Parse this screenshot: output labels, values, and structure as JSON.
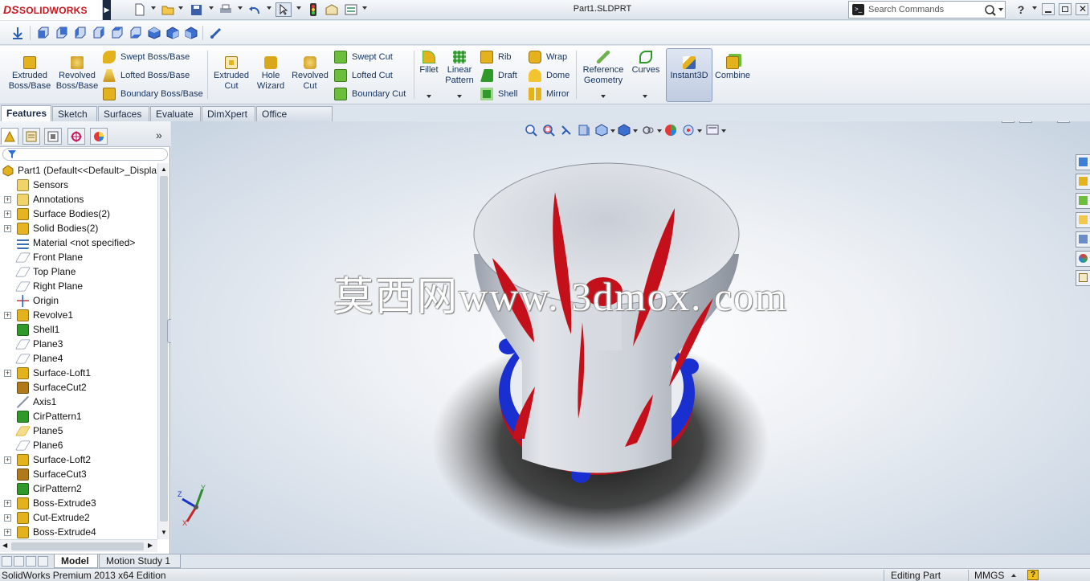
{
  "app": {
    "logo_ds": "DS",
    "logo_text": "SOLIDWORKS",
    "doc_title": "Part1.SLDPRT"
  },
  "search": {
    "placeholder": "Search Commands"
  },
  "ribbon": {
    "big_buttons": [
      {
        "id": "extruded-boss-base",
        "label1": "Extruded",
        "label2": "Boss/Base",
        "color": "#e3b21c"
      },
      {
        "id": "revolved-boss-base",
        "label1": "Revolved",
        "label2": "Boss/Base",
        "color": "#e3b21c"
      },
      {
        "id": "extruded-cut",
        "label1": "Extruded",
        "label2": "Cut",
        "color": "#e3b21c"
      },
      {
        "id": "hole-wizard",
        "label1": "Hole",
        "label2": "Wizard",
        "color": "#d9a81a"
      },
      {
        "id": "revolved-cut",
        "label1": "Revolved",
        "label2": "Cut",
        "color": "#e3b21c"
      },
      {
        "id": "fillet",
        "label1": "Fillet",
        "label2": "",
        "color": "#4fb836"
      },
      {
        "id": "linear-pattern",
        "label1": "Linear",
        "label2": "Pattern",
        "color": "#2f9a2a"
      },
      {
        "id": "reference-geometry",
        "label1": "Reference",
        "label2": "Geometry",
        "color": "#6db24a"
      },
      {
        "id": "curves",
        "label1": "Curves",
        "label2": "",
        "color": "#2f9a2a"
      },
      {
        "id": "instant3d",
        "label1": "Instant3D",
        "label2": "",
        "color": "#8aa6cf"
      },
      {
        "id": "combine",
        "label1": "Combine",
        "label2": "",
        "color": "#e3b21c"
      }
    ],
    "small_buttons": [
      {
        "id": "swept-boss-base",
        "label": "Swept Boss/Base",
        "color": "#e3b21c"
      },
      {
        "id": "lofted-boss-base",
        "label": "Lofted Boss/Base",
        "color": "#e3b21c"
      },
      {
        "id": "boundary-boss-base",
        "label": "Boundary Boss/Base",
        "color": "#e3b21c"
      },
      {
        "id": "swept-cut",
        "label": "Swept Cut",
        "color": "#6bbf3a"
      },
      {
        "id": "lofted-cut",
        "label": "Lofted Cut",
        "color": "#6bbf3a"
      },
      {
        "id": "boundary-cut",
        "label": "Boundary Cut",
        "color": "#6bbf3a"
      },
      {
        "id": "rib",
        "label": "Rib",
        "color": "#e3b21c"
      },
      {
        "id": "draft",
        "label": "Draft",
        "color": "#2f9a2a"
      },
      {
        "id": "shell",
        "label": "Shell",
        "color": "#2f9a2a"
      },
      {
        "id": "wrap",
        "label": "Wrap",
        "color": "#e3b21c"
      },
      {
        "id": "dome",
        "label": "Dome",
        "color": "#e3b21c"
      },
      {
        "id": "mirror",
        "label": "Mirror",
        "color": "#e3b21c"
      }
    ]
  },
  "tabs": [
    "Features",
    "Sketch",
    "Surfaces",
    "Evaluate",
    "DimXpert",
    "Office Products"
  ],
  "tree": {
    "root": "Part1  (Default<<Default>_Displa",
    "items": [
      {
        "label": "Sensors",
        "icon": "sensor-icon",
        "color": "#f0d46a",
        "expand": false
      },
      {
        "label": "Annotations",
        "icon": "annotations-icon",
        "color": "#f0d46a",
        "expand": true
      },
      {
        "label": "Surface Bodies(2)",
        "icon": "surface-bodies-icon",
        "color": "#e6b422",
        "expand": true
      },
      {
        "label": "Solid Bodies(2)",
        "icon": "solid-bodies-icon",
        "color": "#e6b422",
        "expand": true
      },
      {
        "label": "Material <not specified>",
        "icon": "material-icon",
        "color": "#3b6db5",
        "expand": false
      },
      {
        "label": "Front Plane",
        "icon": "plane-icon",
        "color": "#8a97a8",
        "expand": false
      },
      {
        "label": "Top Plane",
        "icon": "plane-icon",
        "color": "#8a97a8",
        "expand": false
      },
      {
        "label": "Right Plane",
        "icon": "plane-icon",
        "color": "#8a97a8",
        "expand": false
      },
      {
        "label": "Origin",
        "icon": "origin-icon",
        "color": "#c0392b",
        "expand": false
      },
      {
        "label": "Revolve1",
        "icon": "revolve-icon",
        "color": "#e3b21c",
        "expand": true
      },
      {
        "label": "Shell1",
        "icon": "shell-icon",
        "color": "#2f9a2a",
        "expand": false
      },
      {
        "label": "Plane3",
        "icon": "plane-icon",
        "color": "#8a97a8",
        "expand": false
      },
      {
        "label": "Plane4",
        "icon": "plane-icon",
        "color": "#8a97a8",
        "expand": false
      },
      {
        "label": "Surface-Loft1",
        "icon": "surface-loft-icon",
        "color": "#e3b21c",
        "expand": true
      },
      {
        "label": "SurfaceCut2",
        "icon": "surface-cut-icon",
        "color": "#b07a1a",
        "expand": false
      },
      {
        "label": "Axis1",
        "icon": "axis-icon",
        "color": "#8a97a8",
        "expand": false
      },
      {
        "label": "CirPattern1",
        "icon": "cirpattern-icon",
        "color": "#2f9a2a",
        "expand": false
      },
      {
        "label": "Plane5",
        "icon": "plane-icon",
        "color": "#d9a81a",
        "expand": false
      },
      {
        "label": "Plane6",
        "icon": "plane-icon",
        "color": "#8a97a8",
        "expand": false
      },
      {
        "label": "Surface-Loft2",
        "icon": "surface-loft-icon",
        "color": "#e3b21c",
        "expand": true
      },
      {
        "label": "SurfaceCut3",
        "icon": "surface-cut-icon",
        "color": "#b07a1a",
        "expand": false
      },
      {
        "label": "CirPattern2",
        "icon": "cirpattern-icon",
        "color": "#2f9a2a",
        "expand": false
      },
      {
        "label": "Boss-Extrude3",
        "icon": "boss-extrude-icon",
        "color": "#e3b21c",
        "expand": true
      },
      {
        "label": "Cut-Extrude2",
        "icon": "cut-extrude-icon",
        "color": "#e3b21c",
        "expand": true
      },
      {
        "label": "Boss-Extrude4",
        "icon": "boss-extrude-icon",
        "color": "#e3b21c",
        "expand": true
      }
    ]
  },
  "viewport": {
    "watermark": "莫西网www. 3dmox. com",
    "axis_y": "Y",
    "axis_z": "Z",
    "axis_x": "X"
  },
  "bottom_tabs": [
    "Model",
    "Motion Study 1"
  ],
  "status": {
    "edition": "SolidWorks Premium 2013 x64 Edition",
    "mode": "Editing Part",
    "units": "MMGS",
    "help": "?"
  }
}
